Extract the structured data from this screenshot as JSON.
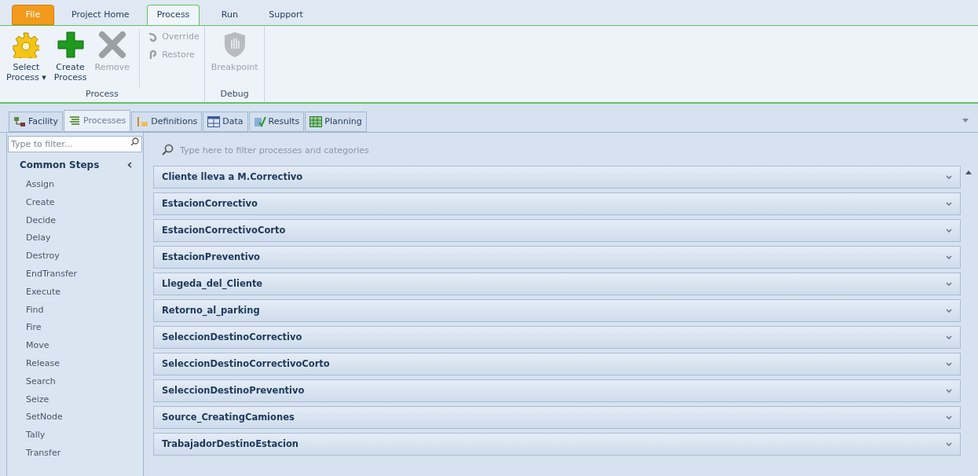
{
  "file_menu": "File",
  "ribbon_tabs": [
    {
      "label": "Project Home",
      "selected": false
    },
    {
      "label": "Process",
      "selected": true
    },
    {
      "label": "Run",
      "selected": false
    },
    {
      "label": "Support",
      "selected": false
    }
  ],
  "ribbon_groups": [
    {
      "label": "Process",
      "buttons": [
        {
          "kind": "large",
          "label": "Select",
          "label2": "Process ▾",
          "disabled": false
        },
        {
          "kind": "large",
          "label": "Create",
          "label2": "Process",
          "disabled": false
        },
        {
          "kind": "large",
          "label": "Remove",
          "disabled": true
        },
        {
          "kind": "small-stack",
          "items": [
            {
              "label": "Override",
              "disabled": true
            },
            {
              "label": "Restore",
              "disabled": true
            }
          ]
        }
      ]
    },
    {
      "label": "Debug",
      "buttons": [
        {
          "kind": "large",
          "label": "Breakpoint",
          "disabled": true
        }
      ]
    }
  ],
  "view_tabs": [
    {
      "label": "Facility",
      "selected": false
    },
    {
      "label": "Processes",
      "selected": true
    },
    {
      "label": "Definitions",
      "selected": false
    },
    {
      "label": "Data",
      "selected": false
    },
    {
      "label": "Results",
      "selected": false
    },
    {
      "label": "Planning",
      "selected": false
    }
  ],
  "sidebar": {
    "filter": {
      "placeholder": "Type to filter..."
    },
    "category": "Common Steps",
    "items": [
      "Assign",
      "Create",
      "Decide",
      "Delay",
      "Destroy",
      "EndTransfer",
      "Execute",
      "Find",
      "Fire",
      "Move",
      "Release",
      "Search",
      "Seize",
      "SetNode",
      "Tally",
      "Transfer"
    ]
  },
  "process_list": {
    "filter": {
      "placeholder": "Type here to filter processes and categories"
    },
    "processes": [
      "Cliente lleva a M.Correctivo",
      "EstacionCorrectivo",
      "EstacionCorrectivoCorto",
      "EstacionPreventivo",
      "Llegeda_del_Cliente",
      "Retorno_al_parking",
      "SeleccionDestinoCorrectivo",
      "SeleccionDestinoCorrectivoCorto",
      "SeleccionDestinoPreventivo",
      "Source_CreatingCamiones",
      "TrabajadorDestinoEstacion"
    ]
  }
}
